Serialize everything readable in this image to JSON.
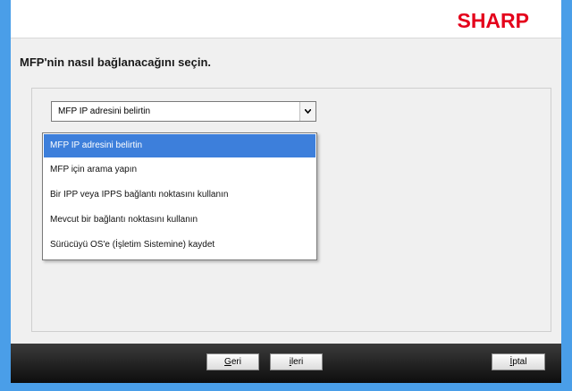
{
  "header": {
    "brand": "SHARP"
  },
  "prompt": "MFP'nin nasıl bağlanacağını seçin.",
  "select": {
    "value": "MFP IP adresini belirtin",
    "options": [
      "MFP IP adresini belirtin",
      "MFP için arama yapın",
      "Bir IPP veya IPPS bağlantı noktasını kullanın",
      "Mevcut bir bağlantı noktasını kullanın",
      "Sürücüyü OS'e (İşletim Sistemine) kaydet"
    ],
    "selected_index": 0
  },
  "footer": {
    "back_label": "Geri",
    "next_label": "ileri",
    "cancel_label": "İptal"
  },
  "colors": {
    "brand": "#e4001b",
    "selection": "#3d7fdb",
    "desktop": "#4a9ee8"
  }
}
